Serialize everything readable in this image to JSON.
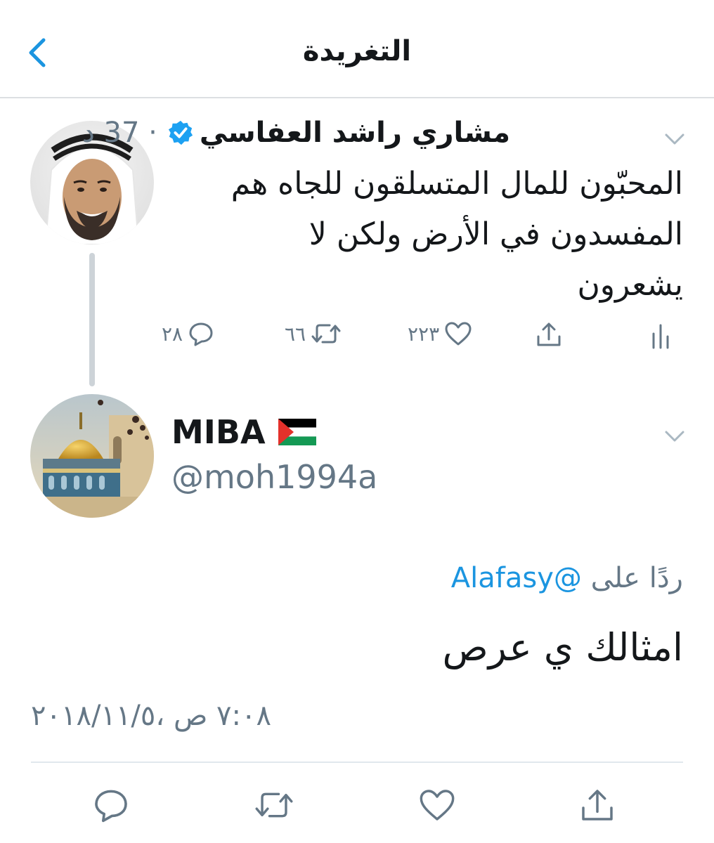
{
  "header": {
    "title": "التغريدة",
    "back_icon": "chevron-left-icon"
  },
  "original_tweet": {
    "display_name": "مشاري راشد العفاسي",
    "verified": true,
    "time": "37 د",
    "separator": "·",
    "text_lines": [
      "المحبّون للمال المتسلقون للجاه هم",
      "المفسدون في الأرض ولكن لا",
      "يشعرون"
    ],
    "actions": {
      "replies": "٢٨",
      "retweets": "٦٦",
      "likes": "٢٢٣"
    }
  },
  "reply_tweet": {
    "display_name": "MIBA",
    "flag": "palestine-flag",
    "handle": "@moh1994a",
    "reply_to_label": "ردًا على",
    "reply_to_handle": "@Alafasy",
    "text": "امثالك ي عرص",
    "timestamp": "٧:٠٨ ص ،٢٠١٨/١١/٥"
  },
  "colors": {
    "accent": "#1b95e0",
    "muted": "#657786",
    "text": "#14171a",
    "thread_line": "#cdd3d8"
  }
}
